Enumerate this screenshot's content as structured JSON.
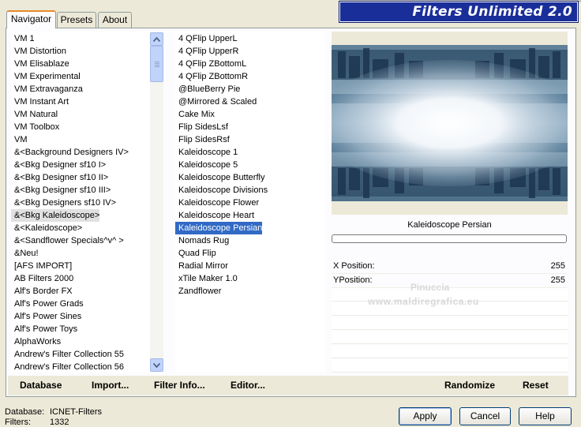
{
  "window": {
    "title": "Filters Unlimited 2.0"
  },
  "tabs": [
    "Navigator",
    "Presets",
    "About"
  ],
  "categories": {
    "items": [
      "VM 1",
      "VM Distortion",
      "VM Elisablaze",
      "VM Experimental",
      "VM Extravaganza",
      "VM Instant Art",
      "VM Natural",
      "VM Toolbox",
      "VM",
      "&<Background Designers IV>",
      "&<Bkg Designer sf10 I>",
      "&<Bkg Designer sf10 II>",
      "&<Bkg Designer sf10 III>",
      "&<Bkg Designers sf10 IV>",
      "&<Bkg Kaleidoscope>",
      "&<Kaleidoscope>",
      "&<Sandflower Specials^v^ >",
      "&Neu!",
      "[AFS IMPORT]",
      "AB Filters 2000",
      "Alf's Border FX",
      "Alf's Power Grads",
      "Alf's Power Sines",
      "Alf's Power Toys",
      "AlphaWorks",
      "Andrew's Filter Collection 55",
      "Andrew's Filter Collection 56"
    ],
    "selected_index": 14
  },
  "filters": {
    "items": [
      "4 QFlip UpperL",
      "4 QFlip UpperR",
      "4 QFlip ZBottomL",
      "4 QFlip ZBottomR",
      "@BlueBerry Pie",
      "@Mirrored & Scaled",
      "Cake Mix",
      "Flip SidesLsf",
      "Flip SidesRsf",
      "Kaleidoscope 1",
      "Kaleidoscope 5",
      "Kaleidoscope Butterfly",
      "Kaleidoscope Divisions",
      "Kaleidoscope Flower",
      "Kaleidoscope Heart",
      "Kaleidoscope Persian",
      "Nomads Rug",
      "Quad Flip",
      "Radial Mirror",
      "xTile Maker 1.0",
      "Zandflower"
    ],
    "selected_index": 15
  },
  "preview": {
    "filter_name": "Kaleidoscope Persian",
    "progress": 0,
    "params": [
      {
        "name": "X Position:",
        "value": "255"
      },
      {
        "name": "YPosition:",
        "value": "255"
      }
    ],
    "watermark_line1": "Pinuccia",
    "watermark_line2": "www.maldiregrafica.eu"
  },
  "toolbar": {
    "database": "Database",
    "import": "Import...",
    "filter_info": "Filter Info...",
    "editor": "Editor...",
    "randomize": "Randomize",
    "reset": "Reset"
  },
  "status": {
    "database_label": "Database:",
    "database_value": "ICNET-Filters",
    "filters_label": "Filters:",
    "filters_value": "1332"
  },
  "buttons": {
    "apply": "Apply",
    "cancel": "Cancel",
    "help": "Help"
  },
  "colors": {
    "title_bg": "#1a2e9a",
    "selection_blue": "#316ac5",
    "selection_grey": "#e1e1e1",
    "tab_accent": "#e68b2c"
  }
}
